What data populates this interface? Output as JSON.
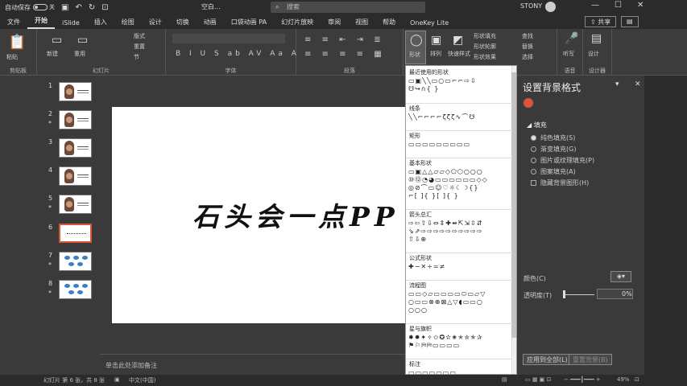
{
  "titlebar": {
    "autosave_label": "自动保存",
    "autosave_state": "关",
    "doc_title": "空白...",
    "search_placeholder": "搜索",
    "user": "STONY",
    "min": "—",
    "restore": "☐",
    "close": "✕"
  },
  "tabs": [
    "文件",
    "开始",
    "iSlide",
    "插入",
    "绘图",
    "设计",
    "切换",
    "动画",
    "口袋动画 PA",
    "幻灯片放映",
    "审阅",
    "视图",
    "帮助",
    "OneKey Lite"
  ],
  "tab_active_index": 1,
  "share": "共享",
  "comment": "批注",
  "ribbon": {
    "paste": "粘贴",
    "clipboard": "剪贴板",
    "new_slide": "新建\n幻灯片",
    "reuse_slide": "重用\n幻灯片",
    "layout": "版式",
    "reset": "重置",
    "section": "节",
    "slides_group": "幻灯片",
    "font_group": "字体",
    "paragraph_group": "段落",
    "shape": "形状",
    "arrange": "排列",
    "quick_styles": "快速样式",
    "shape_fill": "形状填充",
    "shape_outline": "形状轮廓",
    "shape_effects": "形状效果",
    "find": "查找",
    "replace": "替换",
    "select": "选择",
    "dictate": "听写",
    "voice_group": "语音",
    "designer": "设计\n灵感",
    "designer_group": "设计器"
  },
  "slides": [
    {
      "num": "1",
      "star": false,
      "kind": "face"
    },
    {
      "num": "2",
      "star": true,
      "kind": "face"
    },
    {
      "num": "3",
      "star": false,
      "kind": "face"
    },
    {
      "num": "4",
      "star": false,
      "kind": "face"
    },
    {
      "num": "5",
      "star": true,
      "kind": "face"
    },
    {
      "num": "6",
      "star": false,
      "kind": "text",
      "active": true
    },
    {
      "num": "7",
      "star": true,
      "kind": "blue"
    },
    {
      "num": "8",
      "star": true,
      "kind": "blue"
    }
  ],
  "slide": {
    "main_text": "石头会一点PP"
  },
  "notes_placeholder": "单击此处添加备注",
  "shapes_panel": {
    "sections": [
      {
        "title": "最近使用的形状",
        "rows": [
          "▭▣╲╲▭○▭⌐⌐⇨⇩",
          "☋↪∩{ }"
        ]
      },
      {
        "title": "线条",
        "rows": [
          "╲╲⌐⌐⌐⌐ζζζ∿⌒☋"
        ]
      },
      {
        "title": "矩形",
        "rows": [
          "▭▭▭▭▭▭▭▭▭"
        ]
      },
      {
        "title": "基本形状",
        "rows": [
          "▭▣△△▱▱◇⬠⬡○○○",
          "⑩⑫◔◕▭▭▭▭▭▭◇◇",
          "◎⊘⌒▭☺♡☼☾☽{}",
          "⌐[ ]{ }[ ]{ }"
        ]
      },
      {
        "title": "箭头总汇",
        "rows": [
          "⇨⇦⇧⇩⇔⇕✚⇴⇱⇲⇳⇵",
          "⇘⇗⇨⇨⇨⇨⇨⇨⇨⇨⇨⇨",
          "⇧⇩⊕"
        ]
      },
      {
        "title": "公式形状",
        "rows": [
          "✚−✕÷=≠"
        ]
      },
      {
        "title": "流程图",
        "rows": [
          "▭▭◇▱▭▭▭▭⬭▭▱▽",
          "○▭▭⊗⊕⊠△▽◖▭▭○",
          "○○○"
        ]
      },
      {
        "title": "星与旗帜",
        "rows": [
          "✸✹✦✧✩✪✫✬✭✮✯✰",
          "⚑⚐⛿⛿▭▭▭▭"
        ]
      },
      {
        "title": "标注",
        "rows": [
          "▭▭▭▭▭▭▭"
        ]
      }
    ]
  },
  "format_pane": {
    "title": "设置背景格式",
    "fill_header": "填充",
    "options": [
      {
        "label": "纯色填充(S)",
        "type": "radio",
        "on": true
      },
      {
        "label": "渐变填充(G)",
        "type": "radio",
        "on": false
      },
      {
        "label": "图片或纹理填充(P)",
        "type": "radio",
        "on": false
      },
      {
        "label": "图案填充(A)",
        "type": "radio",
        "on": false
      },
      {
        "label": "隐藏背景图形(H)",
        "type": "check",
        "on": false
      }
    ],
    "color_label": "颜色(C)",
    "transparency_label": "透明度(T)",
    "transparency_value": "0%",
    "apply_all": "应用到全部(L)",
    "reset_bg": "重置背景(B)"
  },
  "status": {
    "slide_info": "幻灯片 第 6 张，共 8 张",
    "language": "中文(中国)",
    "notes": "备注",
    "zoom": "49%"
  }
}
